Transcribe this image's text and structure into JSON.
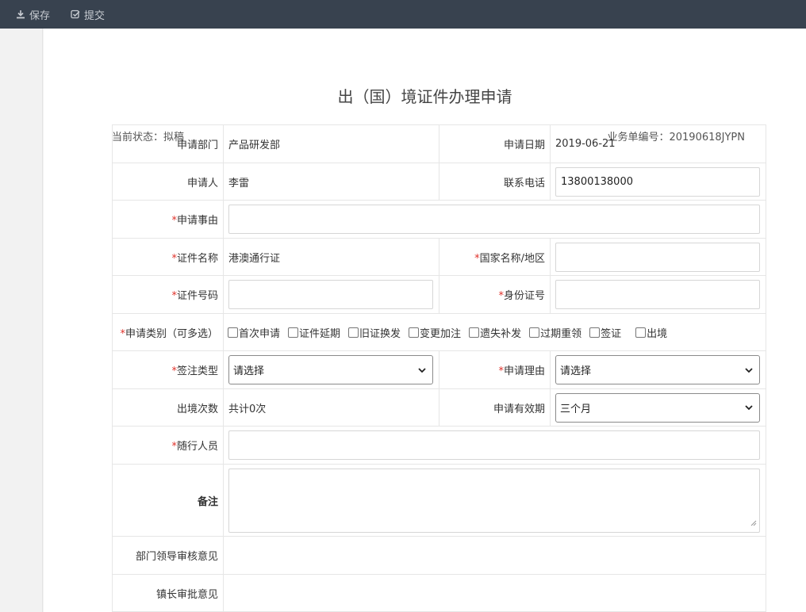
{
  "toolbar": {
    "save_label": "保存",
    "submit_label": "提交"
  },
  "page": {
    "title": "出（国）境证件办理申请",
    "status_label": "当前状态：拟稿",
    "docno_label": "业务单编号：20190618JYPN"
  },
  "form": {
    "dept_label": "申请部门",
    "dept_value": "产品研发部",
    "date_label": "申请日期",
    "date_value": "2019-06-21",
    "applicant_label": "申请人",
    "applicant_value": "李雷",
    "phone_label": "联系电话",
    "phone_value": "13800138000",
    "matter_label": "申请事由",
    "cert_name_label": "证件名称",
    "cert_name_value": "港澳通行证",
    "country_label": "国家名称/地区",
    "cert_no_label": "证件号码",
    "id_no_label": "身份证号",
    "category_label": "申请类别（可多选）",
    "categories": [
      "首次申请",
      "证件延期",
      "旧证换发",
      "变更加注",
      "遗失补发",
      "过期重领",
      "签证",
      "出境"
    ],
    "visa_type_label": "签注类型",
    "visa_type_value": "请选择",
    "reason_label": "申请理由",
    "reason_value": "请选择",
    "exit_count_label": "出境次数",
    "exit_count_value": "共计0次",
    "validity_label": "申请有效期",
    "validity_value": "三个月",
    "companions_label": "随行人员",
    "remarks_label": "备注",
    "dept_review_label": "部门领导审核意见",
    "mayor_review_label": "镇长审批意见",
    "required_mark": "*"
  }
}
